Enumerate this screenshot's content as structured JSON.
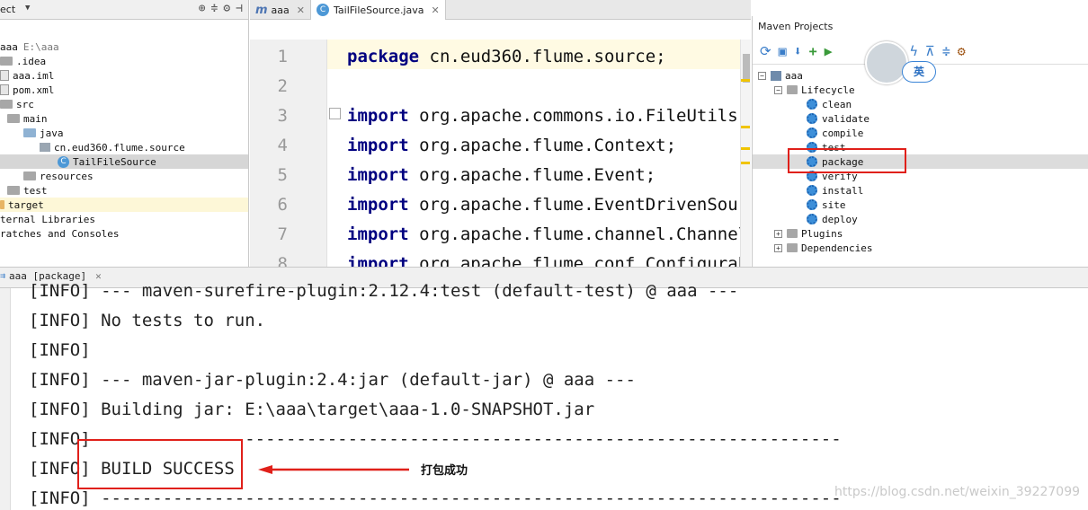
{
  "project": {
    "title": "ect",
    "root_name": "aaa",
    "root_path": "E:\\aaa",
    "items": [
      {
        "label": ".idea",
        "icon": "folder-icon"
      },
      {
        "label": "aaa.iml",
        "icon": "file-icon"
      },
      {
        "label": "pom.xml",
        "icon": "file-icon"
      },
      {
        "label": "src",
        "icon": "folder-icon"
      },
      {
        "label": "main",
        "icon": "folder-icon"
      },
      {
        "label": "java",
        "icon": "folder-icon"
      },
      {
        "label": "cn.eud360.flume.source",
        "icon": "package-icon"
      },
      {
        "label": "TailFileSource",
        "icon": "class-icon"
      },
      {
        "label": "resources",
        "icon": "folder-icon"
      },
      {
        "label": "test",
        "icon": "folder-icon"
      },
      {
        "label": "target",
        "icon": "folder-icon"
      },
      {
        "label": "ternal Libraries",
        "icon": "library-icon"
      },
      {
        "label": "ratches and Consoles",
        "icon": "scratch-icon"
      }
    ]
  },
  "editor": {
    "tabs": [
      {
        "label": "aaa",
        "icon": "maven-icon"
      },
      {
        "label": "TailFileSource.java",
        "icon": "class-icon"
      }
    ],
    "class_letter": "C",
    "lines": [
      {
        "num": "1",
        "kw": "package",
        "rest": " cn.eud360.flume.source;"
      },
      {
        "num": "2",
        "kw": "",
        "rest": ""
      },
      {
        "num": "3",
        "kw": "import",
        "rest": " org.apache.commons.io.FileUtils;"
      },
      {
        "num": "4",
        "kw": "import",
        "rest": " org.apache.flume.Context;"
      },
      {
        "num": "5",
        "kw": "import",
        "rest": " org.apache.flume.Event;"
      },
      {
        "num": "6",
        "kw": "import",
        "rest": " org.apache.flume.EventDrivenSource"
      },
      {
        "num": "7",
        "kw": "import",
        "rest": " org.apache.flume.channel.ChannelPr"
      },
      {
        "num": "8",
        "kw": "import",
        "rest": " org.apache.flume.conf.Configurable"
      }
    ]
  },
  "maven": {
    "title": "Maven Projects",
    "project": "aaa",
    "lifecycle": "Lifecycle",
    "phases": [
      "clean",
      "validate",
      "compile",
      "test",
      "package",
      "verify",
      "install",
      "site",
      "deploy"
    ],
    "plugins": "Plugins",
    "dependencies": "Dependencies",
    "ime_label": "英"
  },
  "run": {
    "tab_label": "aaa [package]",
    "lines": [
      "[INFO] --- maven-surefire-plugin:2.12.4:test (default-test) @ aaa ---",
      "[INFO] No tests to run.",
      "[INFO]",
      "[INFO] --- maven-jar-plugin:2.4:jar (default-jar) @ aaa ---",
      "[INFO] Building jar: E:\\aaa\\target\\aaa-1.0-SNAPSHOT.jar",
      "[INFO] ------------------------------------------------------------------------",
      "[INFO] BUILD SUCCESS",
      "[INFO] ------------------------------------------------------------------------"
    ],
    "annotation": "打包成功",
    "annotation_color": "#e0201a"
  },
  "watermark": "https://blog.csdn.net/weixin_39227099"
}
